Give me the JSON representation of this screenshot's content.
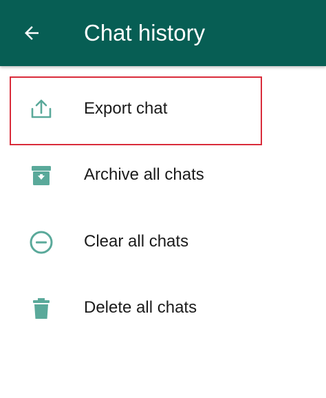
{
  "header": {
    "title": "Chat history",
    "back_icon": "arrow-left-icon",
    "background_color": "#075e54"
  },
  "menu": {
    "items": [
      {
        "label": "Export chat",
        "icon": "export-icon"
      },
      {
        "label": "Archive all chats",
        "icon": "archive-icon"
      },
      {
        "label": "Clear all chats",
        "icon": "minus-circle-icon"
      },
      {
        "label": "Delete all chats",
        "icon": "trash-icon"
      }
    ],
    "icon_color": "#5aa99a",
    "highlighted_item": "Export chat",
    "highlight_color": "#d92b3a"
  }
}
